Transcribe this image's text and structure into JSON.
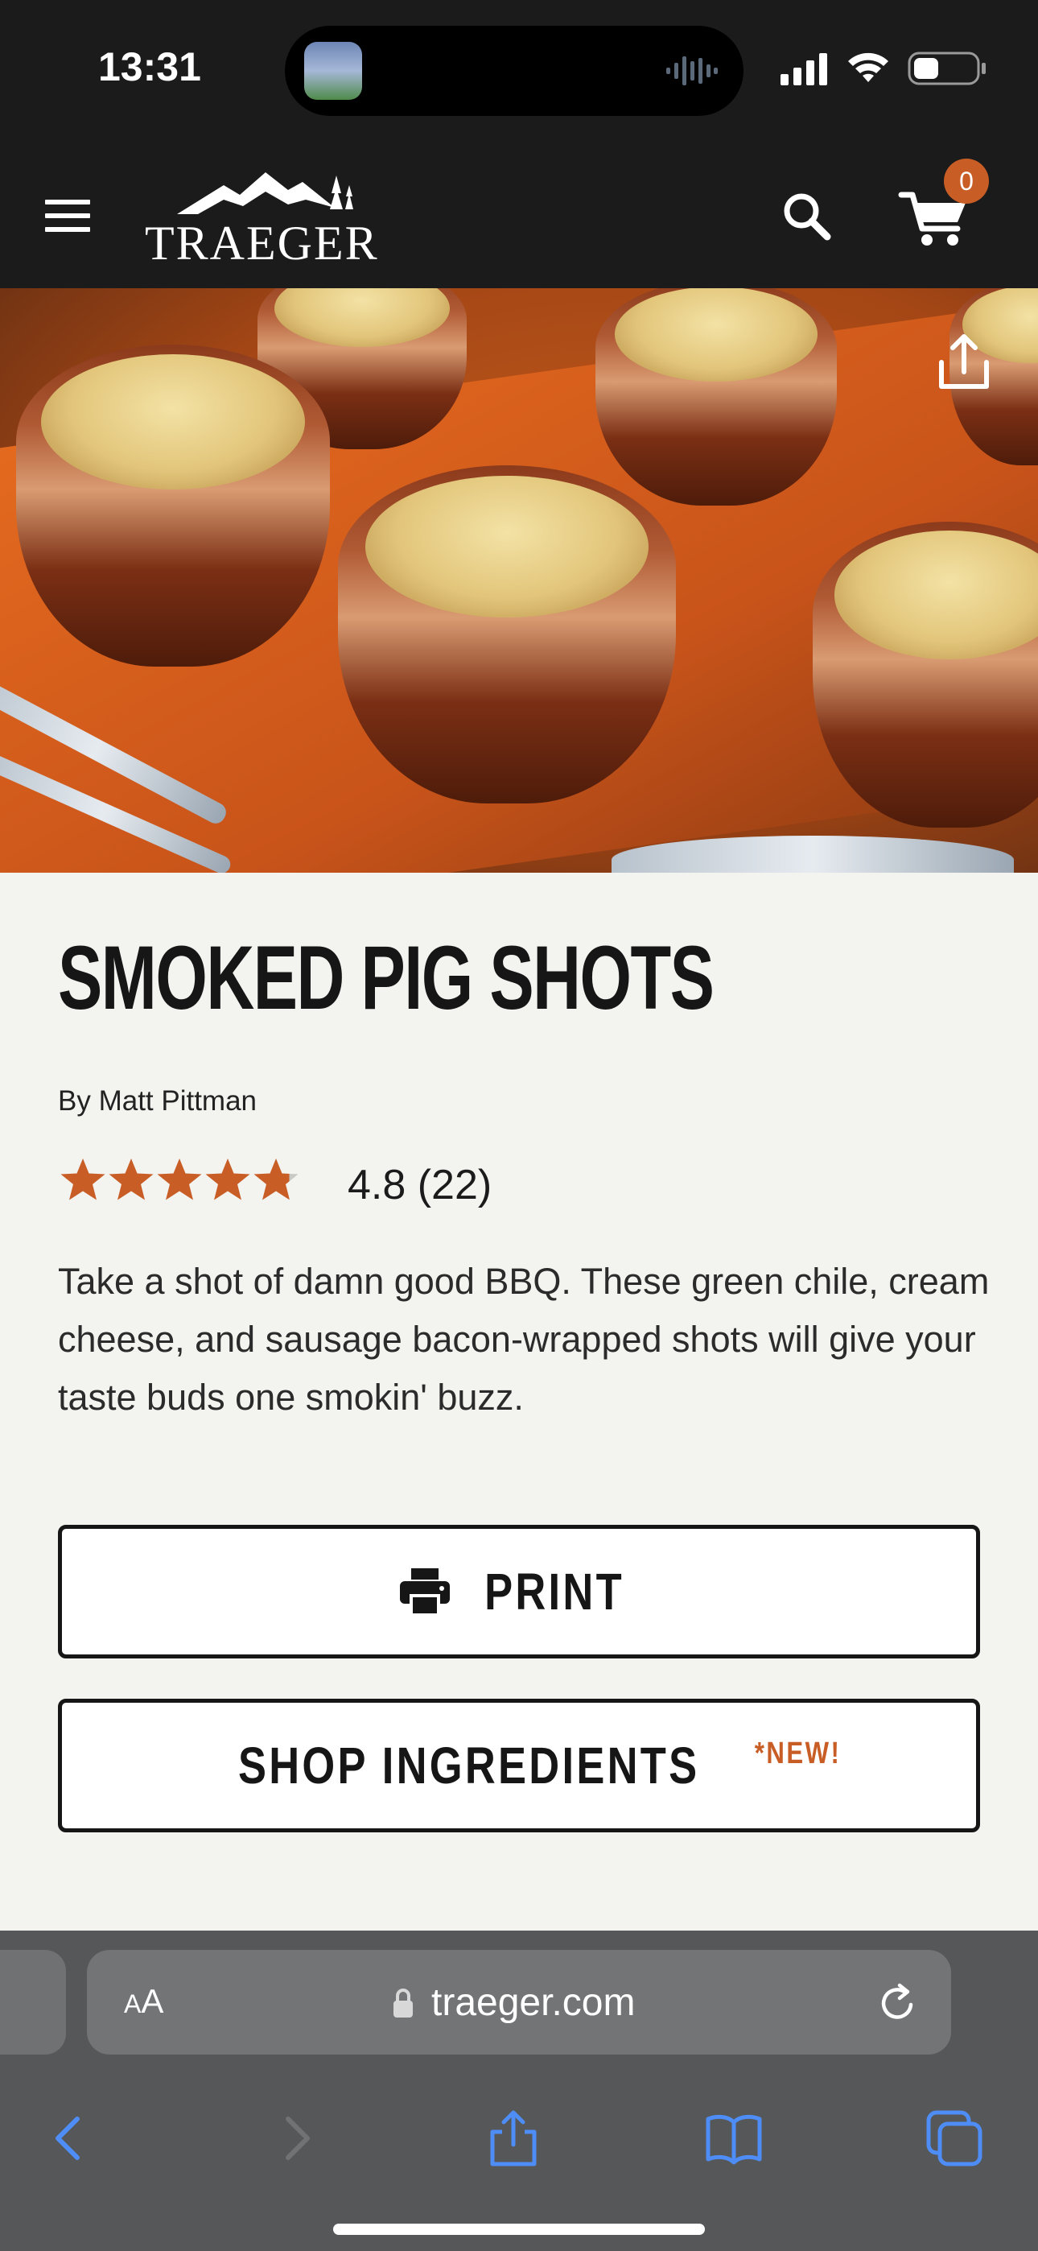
{
  "status_bar": {
    "time": "13:31"
  },
  "header": {
    "logo_text": "TRAEGER",
    "cart_count": "0"
  },
  "recipe": {
    "title": "SMOKED PIG SHOTS",
    "author": "By Matt Pittman",
    "rating_value": 4.8,
    "rating_text": "4.8 (22)",
    "stars_max": 5,
    "description": "Take a shot of damn good BBQ. These green chile, cream cheese, and sausage bacon-wrapped shots will give your taste buds one smokin' buzz."
  },
  "buttons": {
    "print_label": "PRINT",
    "shop_label": "SHOP INGREDIENTS",
    "shop_tag": "*NEW!"
  },
  "browser": {
    "text_size_label_small": "A",
    "text_size_label_large": "A",
    "url": "traeger.com"
  },
  "colors": {
    "accent": "#c85d25",
    "header_bg": "#1b1b1b",
    "page_bg": "#f3f3ef",
    "safari_blue": "#4e8df5"
  },
  "icons": {
    "menu": "hamburger-icon",
    "search": "search-icon",
    "cart": "cart-icon",
    "share": "share-icon",
    "print": "printer-icon",
    "star": "star-icon"
  }
}
